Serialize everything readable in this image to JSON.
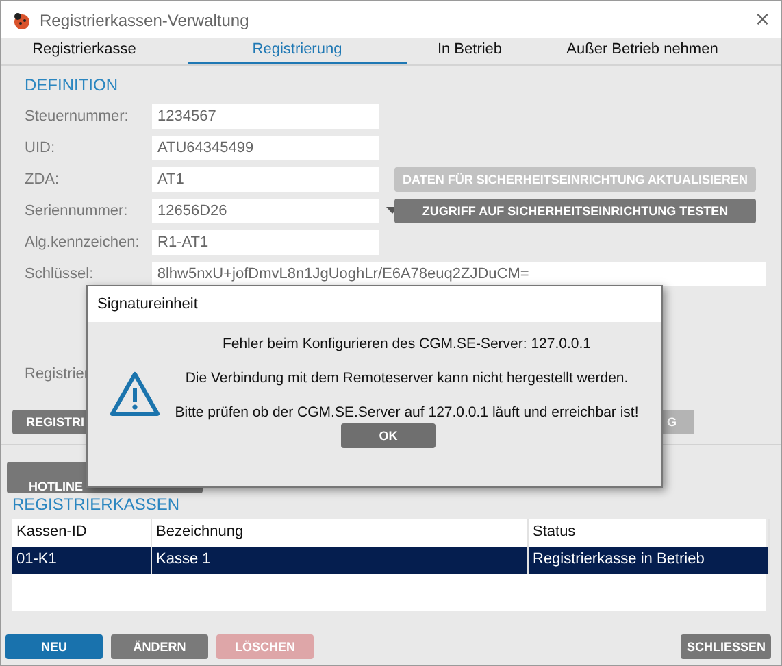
{
  "window": {
    "title": "Registrierkassen-Verwaltung",
    "close": "×"
  },
  "tabs": [
    {
      "label": "Registrierkasse",
      "selected": false
    },
    {
      "label": "Registrierung",
      "selected": true
    },
    {
      "label": "In Betrieb",
      "selected": false
    },
    {
      "label": "Außer Betrieb nehmen",
      "selected": false
    }
  ],
  "definition": {
    "heading": "DEFINITION",
    "fields": [
      {
        "label": "Steuernummer:",
        "value": "1234567",
        "kind": "text"
      },
      {
        "label": "UID:",
        "value": "ATU64345499",
        "kind": "text"
      },
      {
        "label": "ZDA:",
        "value": "AT1",
        "kind": "text",
        "button": {
          "label": "DATEN FÜR SICHERHEITSEINRICHTUNG AKTUALISIEREN",
          "disabled": true
        }
      },
      {
        "label": "Seriennummer:",
        "value": "12656D26",
        "kind": "dropdown",
        "button": {
          "label": "ZUGRIFF AUF SICHERHEITSEINRICHTUNG TESTEN",
          "disabled": false
        }
      },
      {
        "label": "Alg.kennzeichen:",
        "value": "R1-AT1",
        "kind": "text"
      },
      {
        "label": "Schlüssel:",
        "value": "8lhw5nxU+jofDmvL8n1JgUoghLr/E6A78euq2ZJDuCM=",
        "kind": "wide"
      }
    ],
    "partial_label": "Registrier",
    "buttons": [
      {
        "label": "REGISTRI",
        "disabled": false
      },
      {
        "label": "G",
        "disabled": true
      }
    ]
  },
  "hotline_button": "HOTLINE",
  "registrierkassen": {
    "heading": "REGISTRIERKASSEN",
    "columns": [
      "Kassen-ID",
      "Bezeichnung",
      "Status"
    ],
    "rows": [
      {
        "cells": [
          "01-K1",
          "Kasse 1",
          "Registrierkasse in Betrieb"
        ],
        "selected": true
      }
    ]
  },
  "footer": {
    "buttons": [
      {
        "label": "NEU",
        "kind": "primary",
        "disabled": false
      },
      {
        "label": "ÄNDERN",
        "kind": "normal",
        "disabled": false
      },
      {
        "label": "LÖSCHEN",
        "kind": "danger",
        "disabled": true
      }
    ],
    "close_button": "SCHLIESSEN"
  },
  "dialog": {
    "title": "Signatureinheit",
    "lines": [
      "Fehler beim Konfigurieren des CGM.SE-Server: 127.0.0.1",
      "Die Verbindung mit dem Remoteserver kann nicht hergestellt werden.",
      "Bitte prüfen ob der CGM.SE.Server auf 127.0.0.1 läuft und erreichbar ist!"
    ],
    "ok": "OK"
  }
}
